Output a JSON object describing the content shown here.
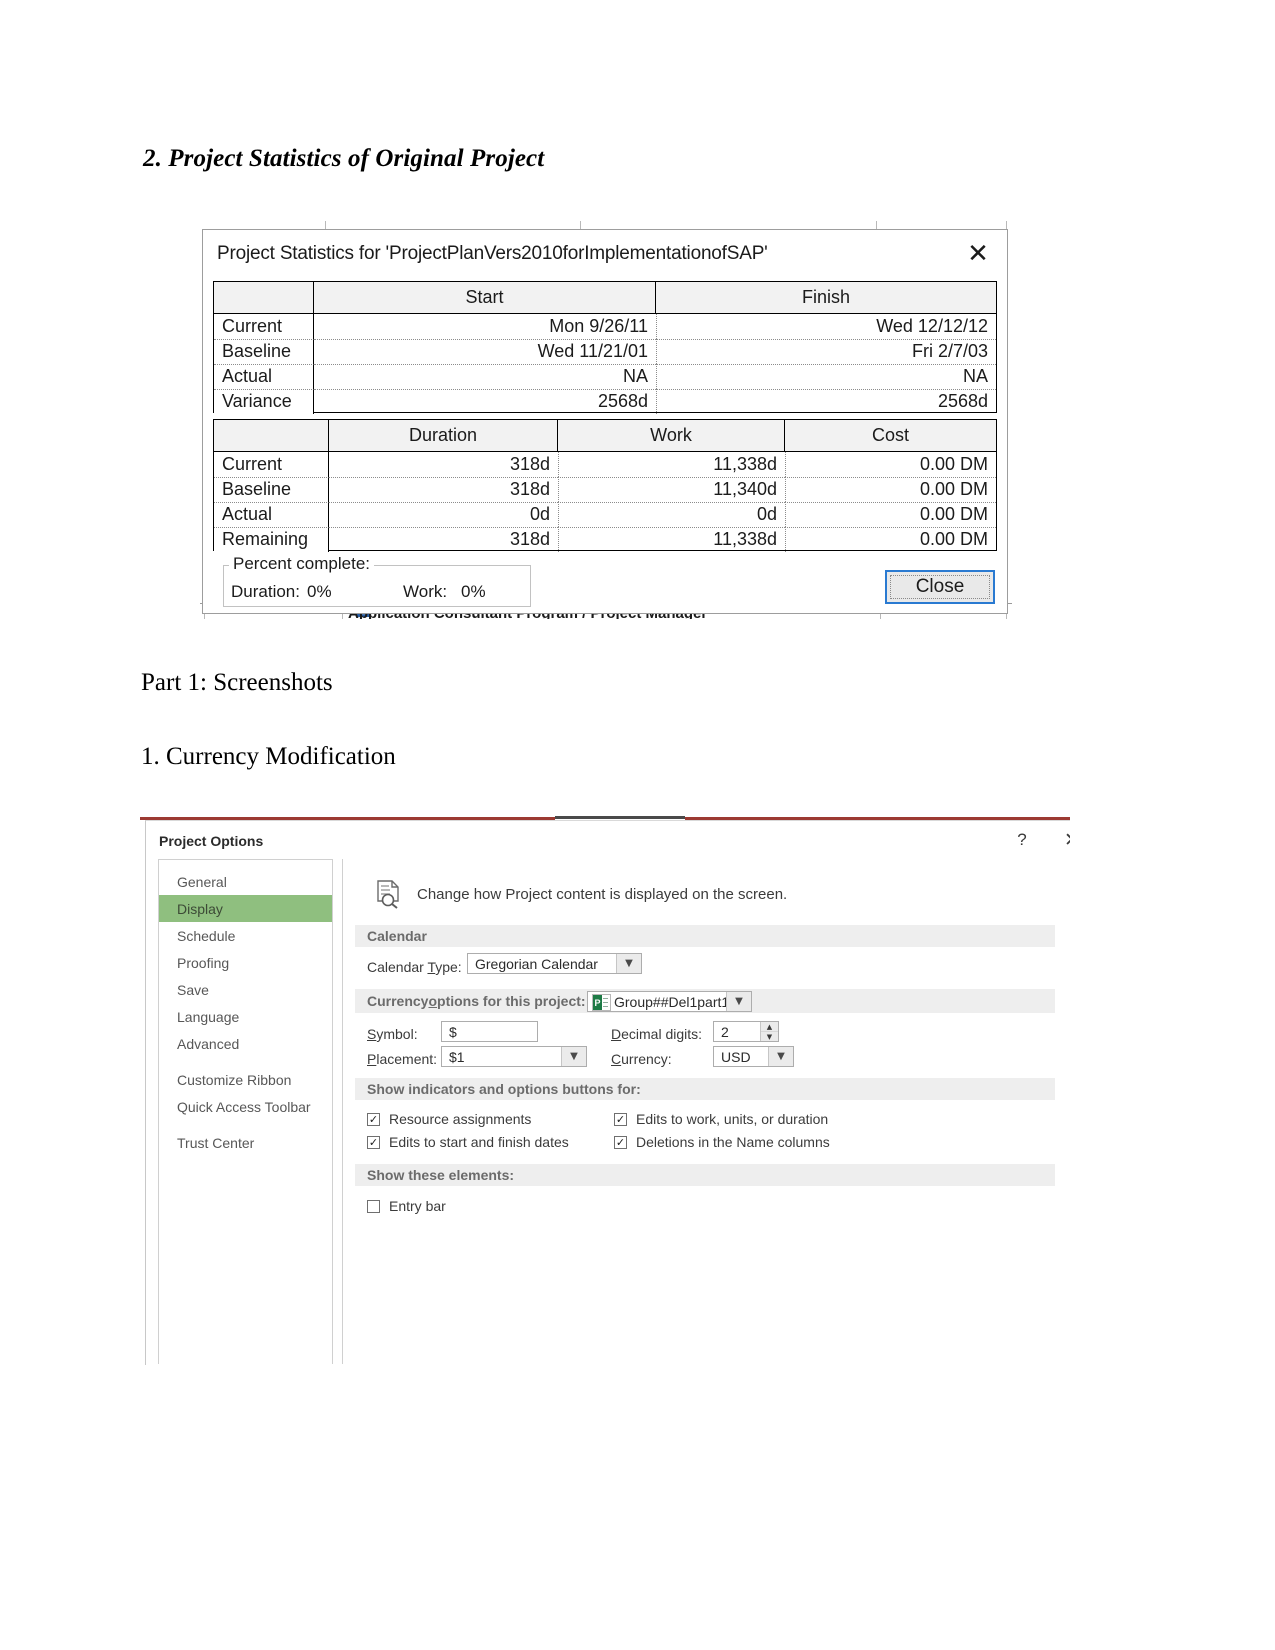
{
  "document": {
    "heading_1": "2. Project Statistics of Original Project",
    "heading_2": "Part 1: Screenshots",
    "heading_3": "1. Currency Modification"
  },
  "project_statistics_dialog": {
    "title": "Project Statistics for 'ProjectPlanVers2010forImplementationofSAP'",
    "close_x_glyph": "✕",
    "schedule_table": {
      "columns": [
        "",
        "Start",
        "Finish"
      ],
      "rows": [
        {
          "label": "Current",
          "start": "Mon 9/26/11",
          "finish": "Wed 12/12/12"
        },
        {
          "label": "Baseline",
          "start": "Wed 11/21/01",
          "finish": "Fri 2/7/03"
        },
        {
          "label": "Actual",
          "start": "NA",
          "finish": "NA"
        },
        {
          "label": "Variance",
          "start": "2568d",
          "finish": "2568d"
        }
      ]
    },
    "work_table": {
      "columns": [
        "",
        "Duration",
        "Work",
        "Cost"
      ],
      "rows": [
        {
          "label": "Current",
          "duration": "318d",
          "work": "11,338d",
          "cost": "0.00 DM"
        },
        {
          "label": "Baseline",
          "duration": "318d",
          "work": "11,340d",
          "cost": "0.00 DM"
        },
        {
          "label": "Actual",
          "duration": "0d",
          "work": "0d",
          "cost": "0.00 DM"
        },
        {
          "label": "Remaining",
          "duration": "318d",
          "work": "11,338d",
          "cost": "0.00 DM"
        }
      ]
    },
    "percent_complete": {
      "legend": "Percent complete:",
      "duration_label": "Duration:",
      "duration_value": "0%",
      "work_label": "Work:",
      "work_value": "0%"
    },
    "close_button": "Close",
    "background_text": "Application Consultant Program / Project Manager",
    "background_icon_glyph": "▤"
  },
  "project_options_dialog": {
    "title": "Project Options",
    "help_glyph": "?",
    "close_glyph": "✕",
    "sidebar": {
      "group_1": [
        "General",
        "Display",
        "Schedule",
        "Proofing",
        "Save",
        "Language",
        "Advanced"
      ],
      "group_2": [
        "Customize Ribbon",
        "Quick Access Toolbar"
      ],
      "group_3": [
        "Trust Center"
      ],
      "active": "Display"
    },
    "intro_text": "Change how Project content is displayed on the screen.",
    "calendar_section": {
      "header": "Calendar",
      "calendar_type_label_pre": "Calendar ",
      "calendar_type_label_u": "T",
      "calendar_type_label_post": "ype:",
      "calendar_type_value": "Gregorian Calendar"
    },
    "currency_section": {
      "header_pre": "Currency ",
      "header_u": "o",
      "header_post": "ptions for this project:",
      "project_selector_value": "Group##Del1part1",
      "symbol_label_u": "S",
      "symbol_label_post": "ymbol:",
      "symbol_value": "$",
      "decimal_label_u": "D",
      "decimal_label_post": "ecimal digits:",
      "decimal_value": "2",
      "placement_label_u": "P",
      "placement_label_post": "lacement:",
      "placement_value": "$1",
      "currency_label_u": "C",
      "currency_label_post": "urrency:",
      "currency_value": "USD"
    },
    "indicators_section": {
      "header": "Show indicators and options buttons for:",
      "checkboxes": [
        {
          "label": "Resource assignments",
          "checked": true
        },
        {
          "label": "Edits to start and finish dates",
          "checked": true
        },
        {
          "label": "Edits to work, units, or duration",
          "checked": true
        },
        {
          "label": "Deletions in the Name columns",
          "checked": true
        }
      ],
      "check_glyph": "✓"
    },
    "elements_section": {
      "header": "Show these elements:",
      "checkbox": {
        "label": "Entry bar",
        "checked": false
      }
    }
  },
  "colors": {
    "sidebar_active_green": "#8fbf7f",
    "accent_red": "#9c3a32",
    "focus_blue": "#2a7ad1",
    "project_icon_green": "#1d7a45"
  }
}
